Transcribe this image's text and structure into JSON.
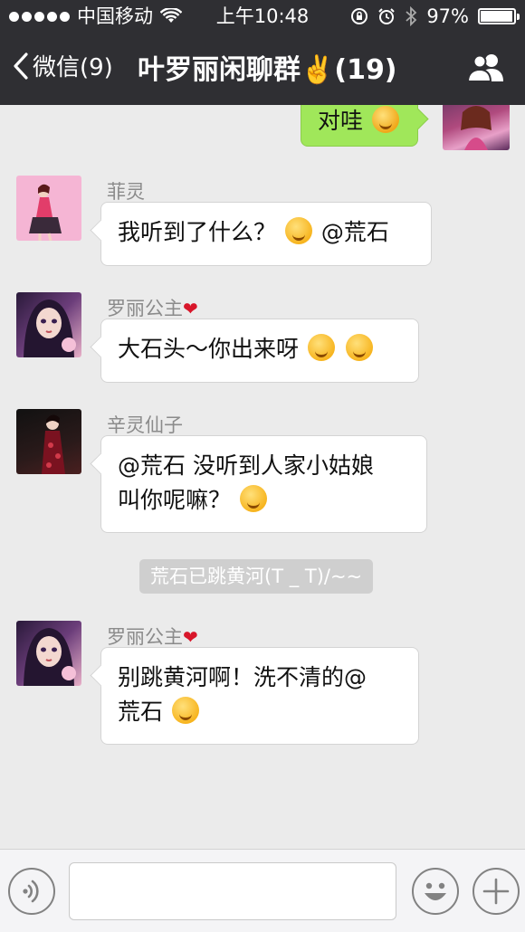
{
  "status_bar": {
    "carrier": "中国移动",
    "time": "上午10:48",
    "battery_percent": "97%",
    "battery_level": 0.97
  },
  "nav": {
    "back_label": "微信(9)",
    "title": "叶罗丽闲聊群✌️(19)"
  },
  "messages": [
    {
      "type": "self",
      "text": "对哇"
    },
    {
      "type": "other",
      "sender": "菲灵",
      "text": "我听到了什么？",
      "mention": "@荒石"
    },
    {
      "type": "other",
      "sender": "罗丽公主",
      "heart": "❤",
      "text": "大石头～你出来呀"
    },
    {
      "type": "other",
      "sender": "辛灵仙子",
      "line1": "@荒石 没听到人家小姑娘",
      "line2": "叫你呢嘛？"
    },
    {
      "type": "system",
      "text": "荒石已跳黄河(T _ T)/~~"
    },
    {
      "type": "other",
      "sender": "罗丽公主",
      "heart": "❤",
      "line1": "别跳黄河啊！洗不清的@",
      "line2": "荒石"
    }
  ],
  "input": {
    "placeholder": ""
  },
  "colors": {
    "nav_bg": "#2f2f33",
    "chat_bg": "#ebebeb",
    "self_bubble": "#a0e75a",
    "other_bubble": "#ffffff"
  }
}
